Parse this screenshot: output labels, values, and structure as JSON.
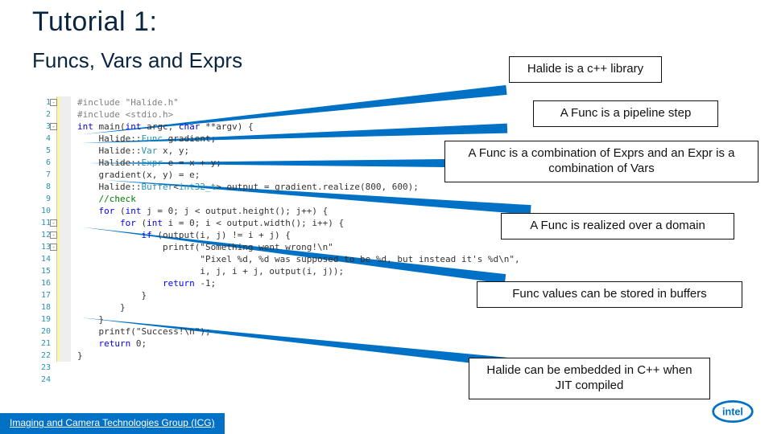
{
  "slide": {
    "title": "Tutorial 1:",
    "subtitle": "Funcs, Vars and Exprs"
  },
  "callouts": {
    "c1": "Halide is a c++ library",
    "c2": "A Func is a pipeline step",
    "c3": "A Func is a combination of Exprs and an Expr is a combination of Vars",
    "c4": "A Func is realized over a domain",
    "c5": "Func values can be stored in buffers",
    "c6": "Halide can be embedded in C++ when JIT compiled"
  },
  "code": {
    "line_numbers": [
      "1",
      "2",
      "3",
      "4",
      "5",
      "6",
      "7",
      "8",
      "9",
      "10",
      "11",
      "12",
      "13",
      "14",
      "15",
      "16",
      "17",
      "18",
      "19",
      "20",
      "21",
      "22",
      "23",
      "24"
    ],
    "lines": [
      {
        "t": "#include \"Halide.h\"",
        "cls": "pp"
      },
      {
        "t": "#include <stdio.h>",
        "cls": "pp"
      },
      {
        "t": "int main(int argc, char **argv) {",
        "cls": "sig"
      },
      {
        "t": "    Halide::Func gradient;",
        "cls": ""
      },
      {
        "t": "    Halide::Var x, y;",
        "cls": ""
      },
      {
        "t": "    Halide::Expr e = x + y;",
        "cls": ""
      },
      {
        "t": "    gradient(x, y) = e;",
        "cls": ""
      },
      {
        "t": "    Halide::Buffer<int32_t> output = gradient.realize(800, 600);",
        "cls": ""
      },
      {
        "t": "",
        "cls": ""
      },
      {
        "t": "    //check",
        "cls": "cmt"
      },
      {
        "t": "    for (int j = 0; j < output.height(); j++) {",
        "cls": ""
      },
      {
        "t": "        for (int i = 0; i < output.width(); i++) {",
        "cls": ""
      },
      {
        "t": "            if (output(i, j) != i + j) {",
        "cls": ""
      },
      {
        "t": "                printf(\"Something went wrong!\\n\"",
        "cls": "str"
      },
      {
        "t": "                       \"Pixel %d, %d was supposed to be %d, but instead it's %d\\n\",",
        "cls": "str"
      },
      {
        "t": "                       i, j, i + j, output(i, j));",
        "cls": ""
      },
      {
        "t": "                return -1;",
        "cls": ""
      },
      {
        "t": "            }",
        "cls": ""
      },
      {
        "t": "        }",
        "cls": ""
      },
      {
        "t": "    }",
        "cls": ""
      },
      {
        "t": "    printf(\"Success!\\n\");",
        "cls": "str"
      },
      {
        "t": "    return 0;",
        "cls": ""
      },
      {
        "t": "}",
        "cls": ""
      },
      {
        "t": "",
        "cls": ""
      }
    ]
  },
  "footer": "Imaging and Camera Technologies Group (ICG)",
  "logo_name": "intel"
}
